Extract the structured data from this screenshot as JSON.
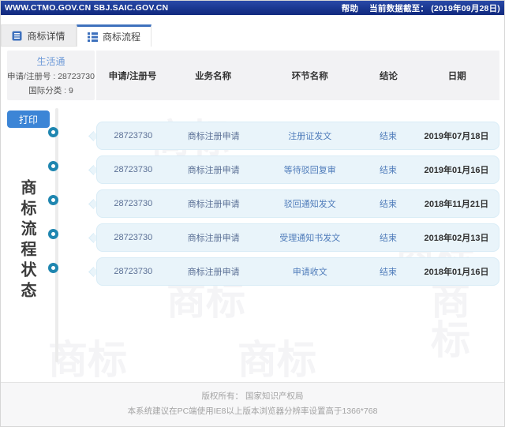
{
  "topbar": {
    "site": "WWW.CTMO.GOV.CN SBJ.SAIC.GOV.CN",
    "help": "帮助",
    "cutoff": "当前数据截至： (2019年09月28日)"
  },
  "tabs": {
    "details": "商标详情",
    "process": "商标流程"
  },
  "info": {
    "name": "生活通",
    "reg": "申请/注册号 : 28723730",
    "intl_class": "国际分类 : 9"
  },
  "print_label": "打印",
  "vertical_title": "商标流程状态",
  "table": {
    "headers": {
      "no": "申请/注册号",
      "business": "业务名称",
      "step": "环节名称",
      "result": "结论",
      "date": "日期"
    },
    "rows": [
      {
        "no": "28723730",
        "business": "商标注册申请",
        "step": "注册证发文",
        "result": "结束",
        "date": "2019年07月18日"
      },
      {
        "no": "28723730",
        "business": "商标注册申请",
        "step": "等待驳回复审",
        "result": "结束",
        "date": "2019年01月16日"
      },
      {
        "no": "28723730",
        "business": "商标注册申请",
        "step": "驳回通知发文",
        "result": "结束",
        "date": "2018年11月21日"
      },
      {
        "no": "28723730",
        "business": "商标注册申请",
        "step": "受理通知书发文",
        "result": "结束",
        "date": "2018年02月13日"
      },
      {
        "no": "28723730",
        "business": "商标注册申请",
        "step": "申请收文",
        "result": "结束",
        "date": "2018年01月16日"
      }
    ]
  },
  "watermark": "商标",
  "footer": {
    "line1": "版权所有： 国家知识产权局",
    "line2": "本系统建议在PC端使用IE8以上版本浏览器分辨率设置高于1366*768"
  },
  "colors": {
    "topbar_navy": "#1c3a94",
    "accent_blue": "#3e71bd",
    "node_teal": "#1f86b0",
    "card_bg": "#e9f4fa",
    "print_button": "#3c85d6"
  }
}
